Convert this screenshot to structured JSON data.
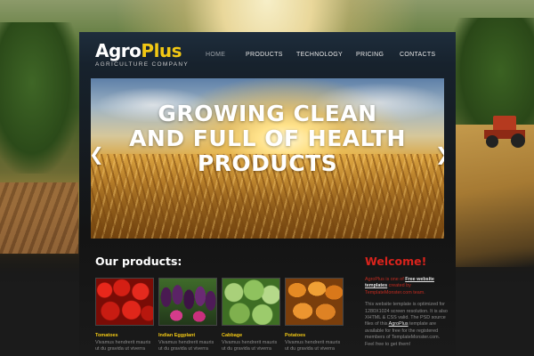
{
  "logo": {
    "agro": "Agro",
    "plus": "Plus",
    "tagline": "AGRICULTURE COMPANY"
  },
  "nav": {
    "items": [
      {
        "label": "HOME",
        "active": true
      },
      {
        "label": "PRODUCTS",
        "active": false
      },
      {
        "label": "TECHNOLOGY",
        "active": false
      },
      {
        "label": "PRICING",
        "active": false
      },
      {
        "label": "CONTACTS",
        "active": false
      }
    ]
  },
  "hero": {
    "line1": "GROWING CLEAN",
    "line2": "AND FULL OF HEALTH",
    "line3": "PRODUCTS",
    "prev_arrow": "❮",
    "next_arrow": "❯"
  },
  "products": {
    "heading": "Our products:",
    "items": [
      {
        "name": "Tomatoes",
        "desc1": "Vivamus hendrerit mauris",
        "desc2": "ut du gravida ut viverra"
      },
      {
        "name": "Indian Eggplant",
        "desc1": "Vivamus hendrerit mauris",
        "desc2": "ut du gravida ut viverra"
      },
      {
        "name": "Cabbage",
        "desc1": "Vivamus hendrerit mauris",
        "desc2": "ut du gravida ut viverra"
      },
      {
        "name": "Potatoes",
        "desc1": "Vivamus hendrerit mauris",
        "desc2": "ut du gravida ut viverra"
      }
    ]
  },
  "welcome": {
    "title": "Welcome!",
    "p1_a": "AgroPlus is one of ",
    "p1_link": "Free website templates",
    "p1_b": " created by TemplateMonster.com team.",
    "p2_a": "This website template is optimized for 1280X1024 screen resolution. It is also XHTML & CSS valid. The PSD source files of this ",
    "p2_link": "AgroPlus",
    "p2_b": " template are available for free for the registered members of TemplateMonster.com. Feel free to get them!"
  },
  "colors": {
    "accent_yellow": "#f2c814",
    "accent_red": "#d9231c"
  }
}
